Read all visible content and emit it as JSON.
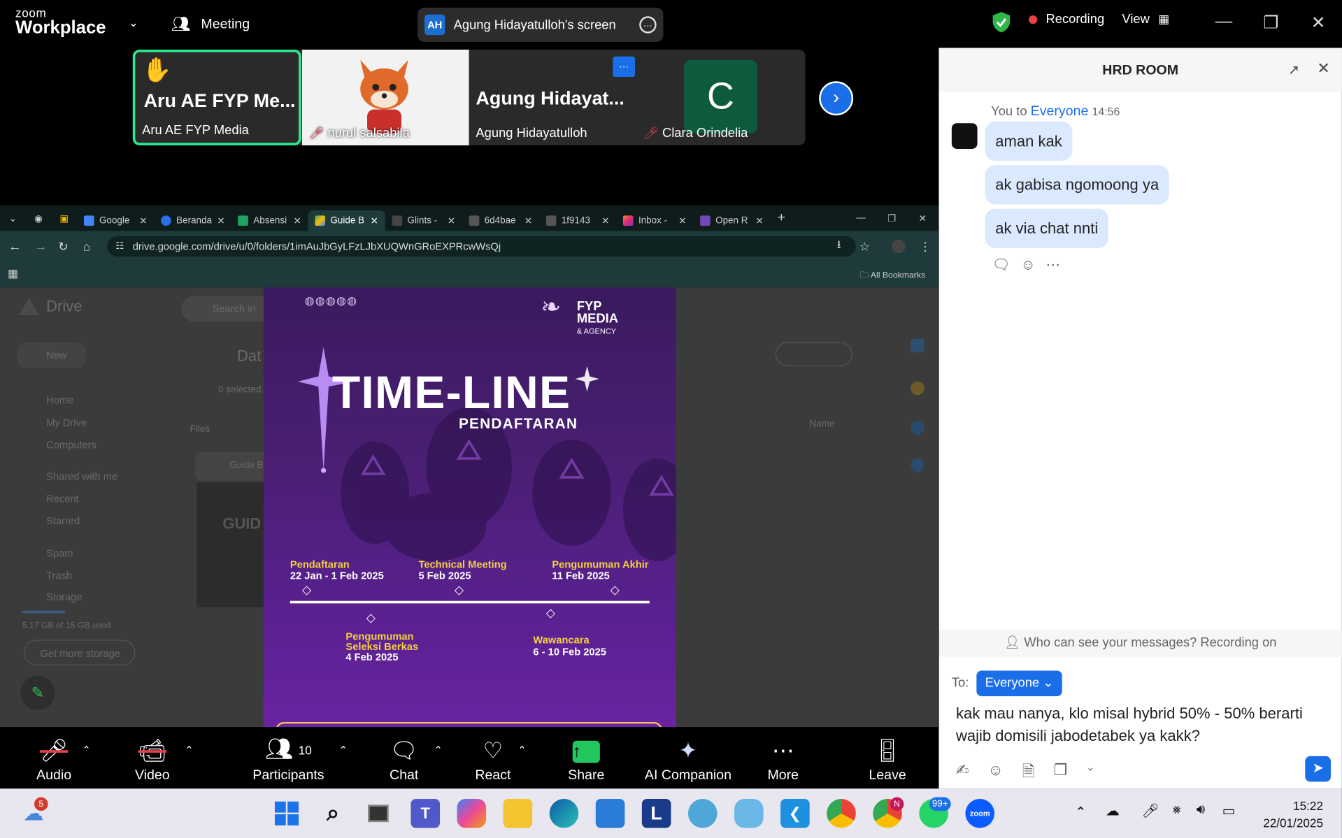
{
  "app": {
    "logo_top": "zoom",
    "logo_bottom": "Workplace",
    "meeting_label": "Meeting",
    "share_initials": "AH",
    "share_label": "Agung Hidayatulloh's screen",
    "recording_label": "Recording",
    "view_label": "View"
  },
  "thumbnails": [
    {
      "big": "Aru AE FYP Me...",
      "small": "Aru AE FYP Media"
    },
    {
      "big": "",
      "small": "nurul salsabila"
    },
    {
      "big": "Agung  Hidayat...",
      "small": "Agung Hidayatulloh"
    },
    {
      "big": "C",
      "small": "Clara Orindelia"
    }
  ],
  "browser": {
    "tabs": [
      "Google",
      "Beranda",
      "Absensi",
      "Guide B",
      "Glints -",
      "6d4bae",
      "1f9143",
      "Inbox -",
      "Open R"
    ],
    "url": "drive.google.com/drive/u/0/folders/1imAuJbGyLFzLJbXUQWnGRoEXPRcwWsQj",
    "bookmarks_label": "All Bookmarks"
  },
  "drive": {
    "title": "Drive",
    "search": "Search in",
    "new_label": "New",
    "nav": [
      "Home",
      "My Drive",
      "Computers",
      "Shared with me",
      "Recent",
      "Starred",
      "Spam",
      "Trash",
      "Storage"
    ],
    "storage": "5.17 GB of 15 GB used",
    "get_storage": "Get more storage",
    "folder_crumb": "Dat",
    "selected": "0 selected",
    "files_label": "Files",
    "name_label": "Name",
    "file_name": "Guide B",
    "thumb_text": "GUID"
  },
  "poster": {
    "brand_top": "FYP",
    "brand_mid": "MEDIA",
    "brand_sub": "& AGENCY",
    "title": "TIME-LINE",
    "subtitle": "PENDAFTARAN",
    "events_top": [
      {
        "title": "Pendaftaran",
        "date": "22 Jan - 1 Feb 2025"
      },
      {
        "title": "Technical Meeting",
        "date": "5 Feb 2025"
      },
      {
        "title": "Pengumuman Akhir",
        "date": "11 Feb 2025"
      }
    ],
    "events_bottom": [
      {
        "title_line1": "Pengumuman",
        "title_line2": "Seleksi Berkas",
        "date": "4 Feb 2025"
      },
      {
        "title_line1": "Wawancara",
        "date": "6 - 10 Feb 2025"
      }
    ]
  },
  "chat": {
    "title": "HRD ROOM",
    "sender_prefix": "You to",
    "recipient": "Everyone",
    "time": "14:56",
    "messages": [
      "aman kak",
      "ak gabisa ngomoong ya",
      "ak via chat nnti"
    ],
    "notice": "Who can see your messages? Recording on",
    "to_label": "To:",
    "to_value": "Everyone",
    "draft_line1": "kak mau nanya, klo misal hybrid 50% - 50% berarti",
    "draft_line2": "wajib domisili jabodetabek ya kakk?"
  },
  "toolbar": {
    "audio": "Audio",
    "video": "Video",
    "participants": "Participants",
    "participants_count": "10",
    "chat": "Chat",
    "react": "React",
    "share": "Share",
    "ai": "AI Companion",
    "more": "More",
    "leave": "Leave"
  },
  "taskbar": {
    "weather_badge": "5",
    "chrome_badge": "N",
    "whatsapp_badge": "99+",
    "time": "15:22",
    "date": "22/01/2025",
    "zoom_label": "zoom",
    "l_label": "L"
  }
}
